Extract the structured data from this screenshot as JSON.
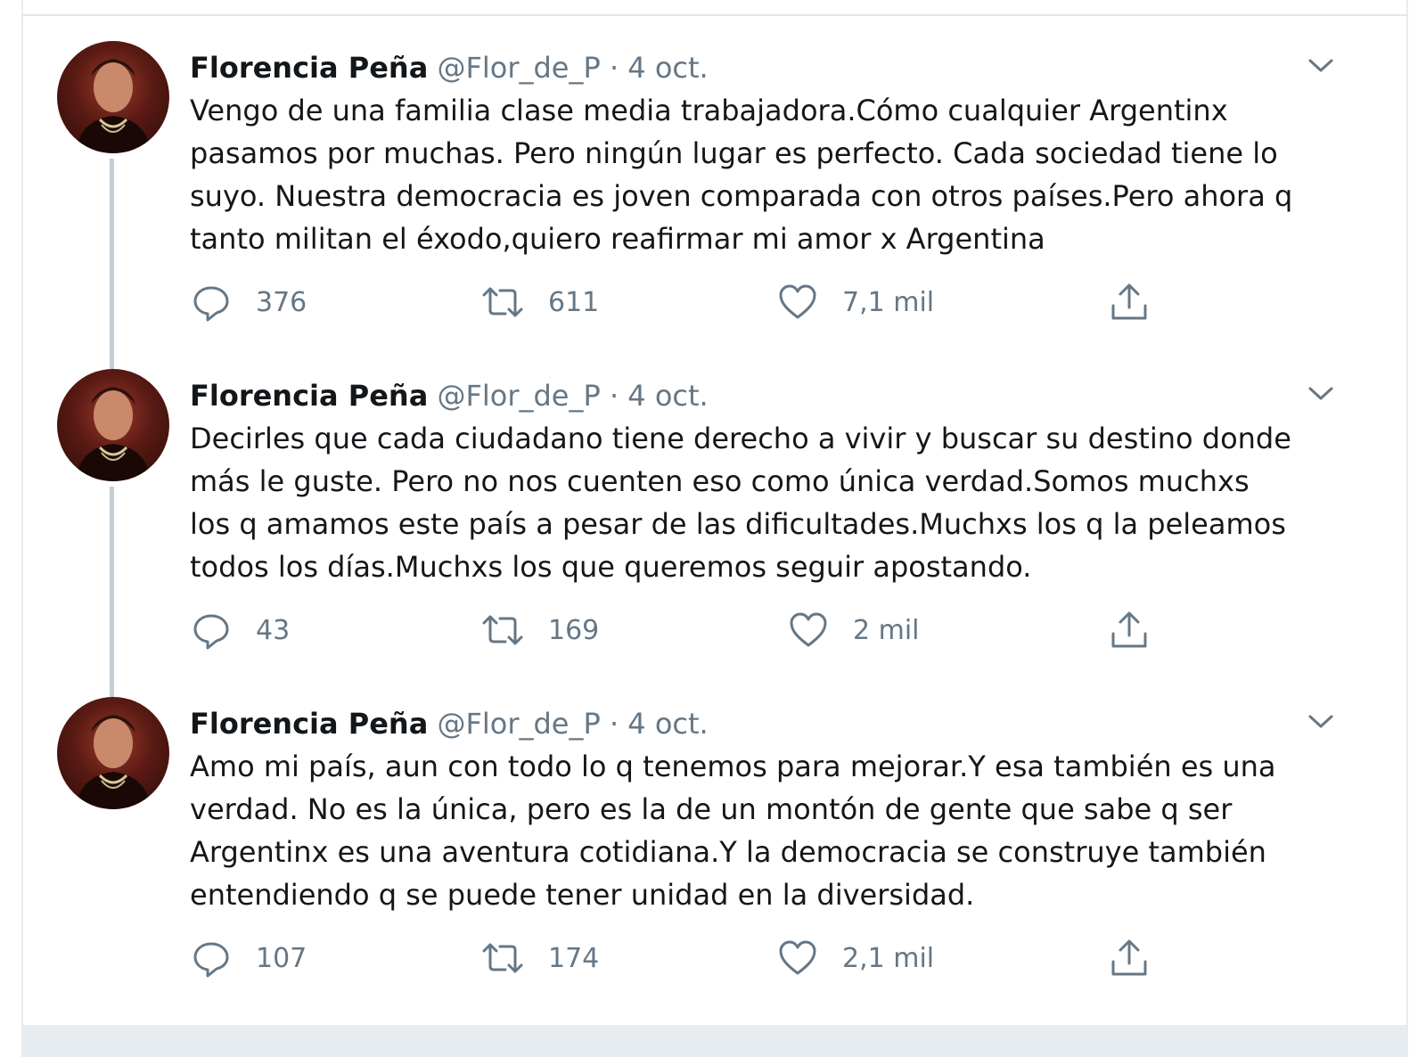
{
  "tweets": [
    {
      "name": "Florencia Peña",
      "handle": "@Flor_de_P",
      "separator": "·",
      "date": "4 oct.",
      "text": "Vengo de una familia clase media trabajadora.Cómo cualquier Argentinx\npasamos por muchas. Pero ningún lugar es perfecto. Cada sociedad tiene lo\nsuyo. Nuestra democracia es joven comparada con otros países.Pero ahora q\ntanto militan el éxodo,quiero reafirmar mi amor x Argentina",
      "replies": "376",
      "retweets": "611",
      "likes": "7,1 mil"
    },
    {
      "name": "Florencia Peña",
      "handle": "@Flor_de_P",
      "separator": "·",
      "date": "4 oct.",
      "text": "Decirles que cada ciudadano tiene derecho a vivir y buscar su destino donde\nmás le guste. Pero no nos cuenten eso como única verdad.Somos muchxs\nlos q amamos este país a pesar de las dificultades.Muchxs los q la peleamos\ntodos los días.Muchxs los que queremos seguir apostando.",
      "replies": "43",
      "retweets": "169",
      "likes": "2 mil"
    },
    {
      "name": "Florencia Peña",
      "handle": "@Flor_de_P",
      "separator": "·",
      "date": "4 oct.",
      "text": "Amo mi país, aun con todo lo q tenemos para mejorar.Y esa también es una\nverdad. No es la única, pero es la de un montón de gente que sabe q ser\nArgentinx es una aventura cotidiana.Y la democracia se construye también\nentendiendo q se puede tener unidad en la diversidad.",
      "replies": "107",
      "retweets": "174",
      "likes": "2,1 mil"
    }
  ],
  "icons": {
    "reply": "reply-icon",
    "retweet": "retweet-icon",
    "like": "heart-icon",
    "share": "share-icon",
    "menu": "chevron-down-icon"
  },
  "colors": {
    "text": "#14171a",
    "secondary": "#657786",
    "border": "#e6ecf0",
    "thread_line": "#c4ced6"
  }
}
